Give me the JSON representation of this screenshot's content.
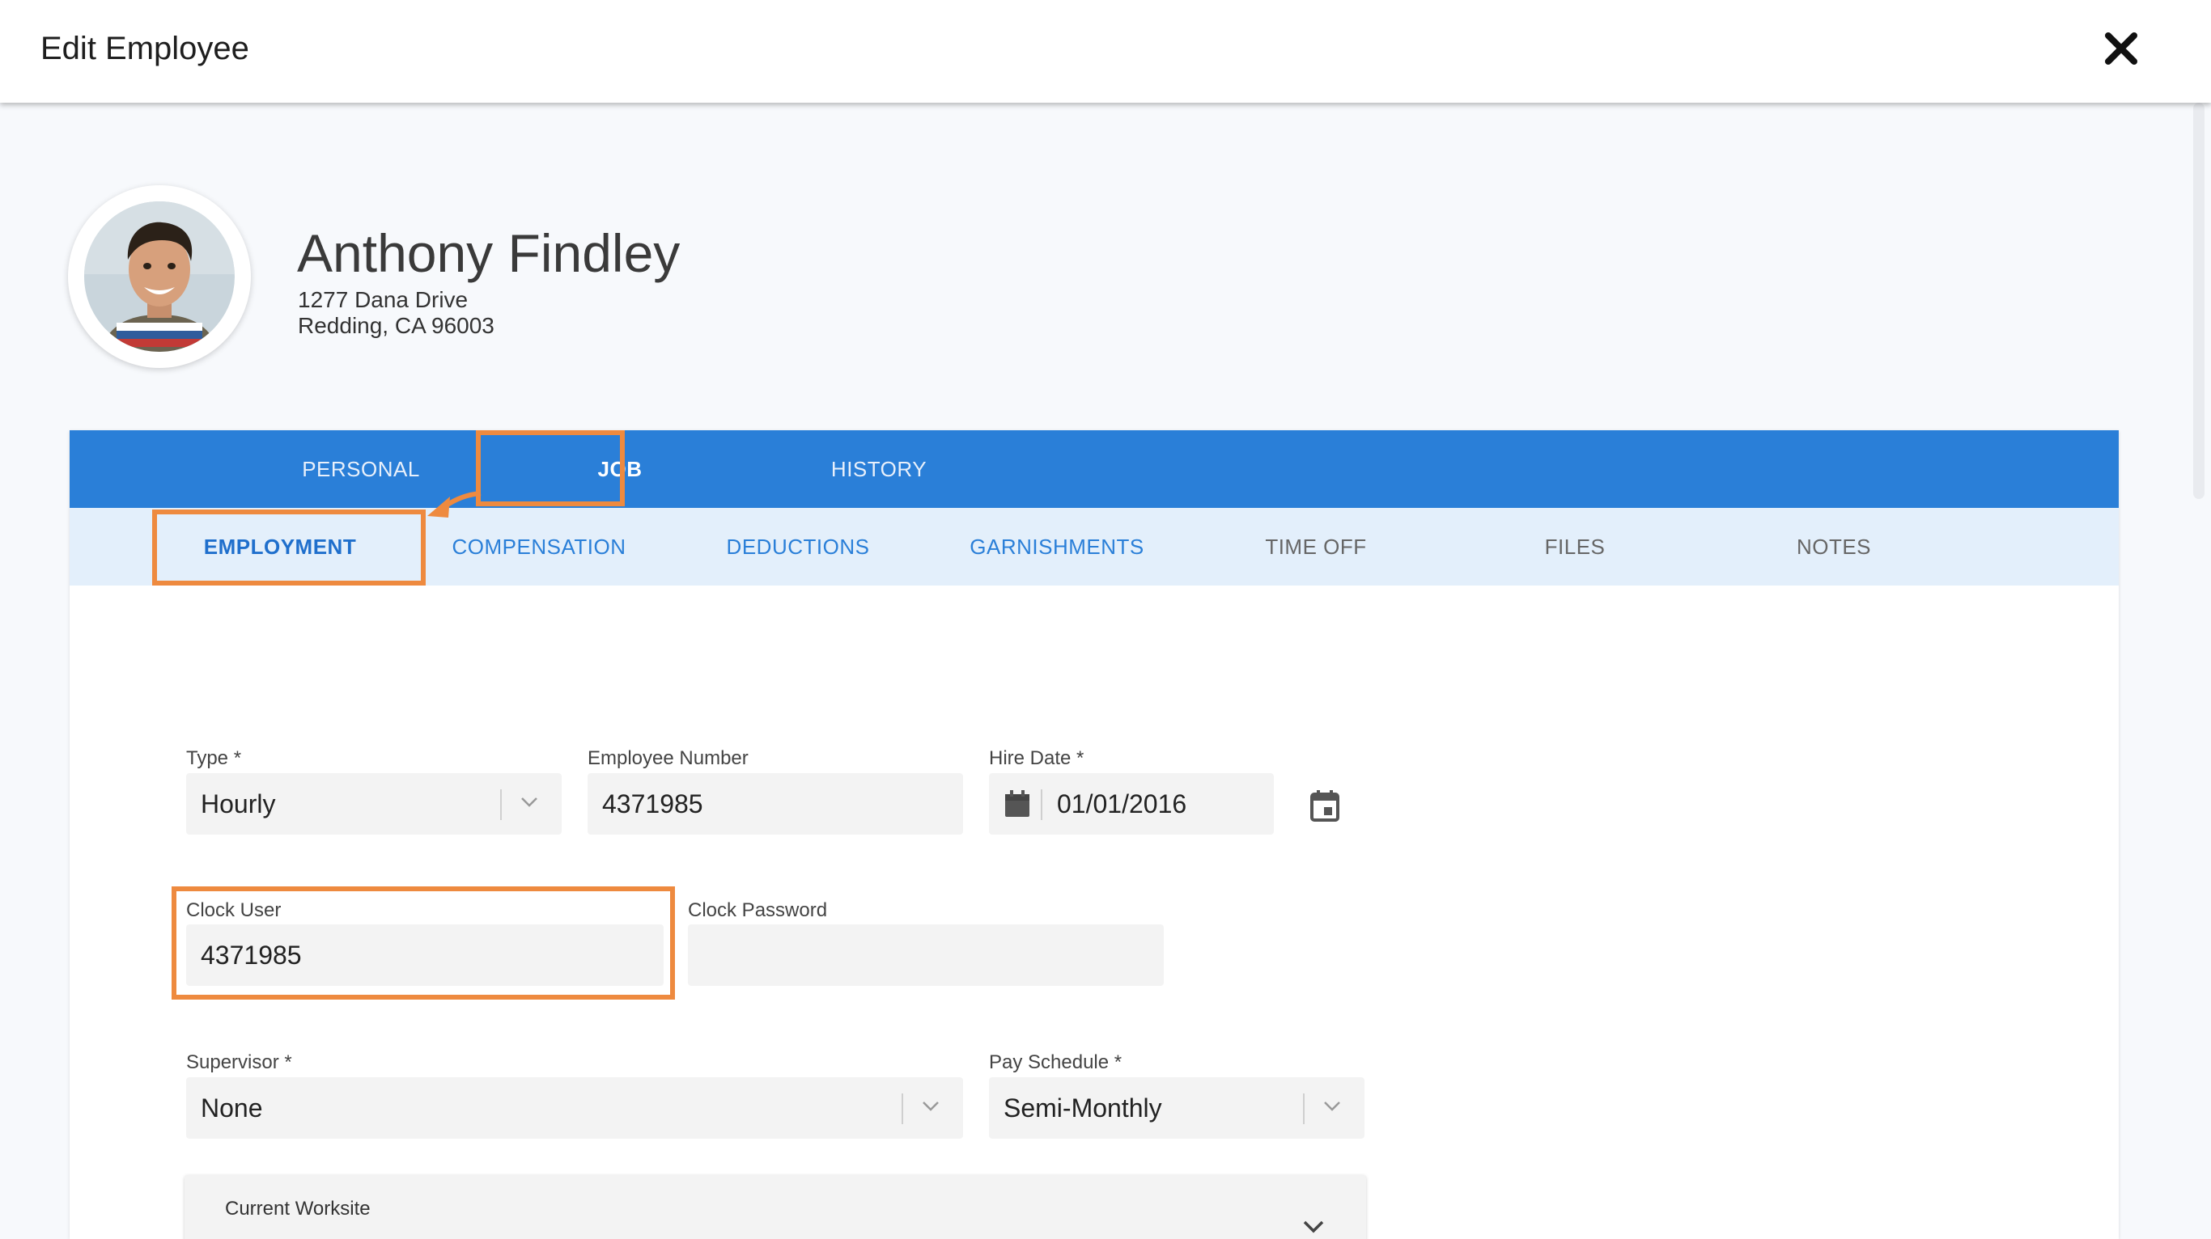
{
  "header": {
    "title": "Edit Employee"
  },
  "employee": {
    "name": "Anthony Findley",
    "address_line1": "1277 Dana Drive",
    "address_line2": "Redding, CA 96003"
  },
  "main_tabs": [
    {
      "label": "PERSONAL"
    },
    {
      "label": "JOB"
    },
    {
      "label": "HISTORY"
    }
  ],
  "sub_tabs": [
    {
      "label": "EMPLOYMENT"
    },
    {
      "label": "COMPENSATION"
    },
    {
      "label": "DEDUCTIONS"
    },
    {
      "label": "GARNISHMENTS"
    },
    {
      "label": "TIME OFF"
    },
    {
      "label": "FILES"
    },
    {
      "label": "NOTES"
    }
  ],
  "form": {
    "type": {
      "label": "Type *",
      "value": "Hourly"
    },
    "employee_number": {
      "label": "Employee Number",
      "value": "4371985"
    },
    "hire_date": {
      "label": "Hire Date *",
      "value": "01/01/2016"
    },
    "clock_user": {
      "label": "Clock User",
      "value": "4371985"
    },
    "clock_password": {
      "label": "Clock Password",
      "value": ""
    },
    "supervisor": {
      "label": "Supervisor *",
      "value": "None"
    },
    "pay_schedule": {
      "label": "Pay Schedule *",
      "value": "Semi-Monthly"
    },
    "current_worksite": {
      "label": "Current Worksite"
    }
  },
  "colors": {
    "primary_blue": "#2a7fd8",
    "sub_tab_bg": "#e3effb",
    "highlight_orange": "#ee8a3f"
  },
  "icons": [
    "close-icon",
    "calendar-icon",
    "calendar-picker-icon",
    "chevron-down-icon"
  ]
}
